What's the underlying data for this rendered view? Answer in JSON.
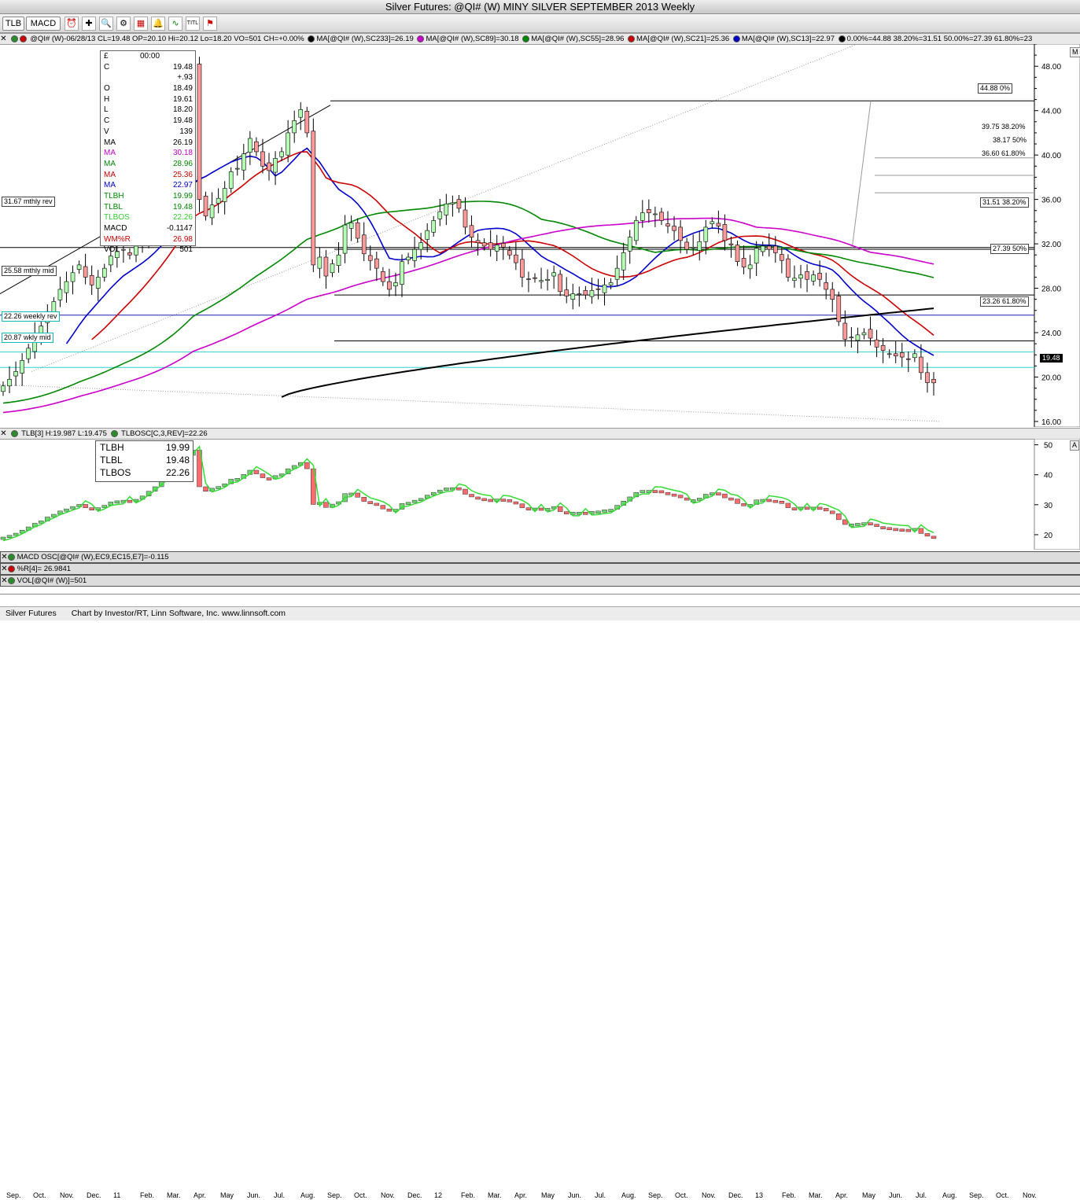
{
  "window": {
    "title": "Silver Futures: @QI# (W) MINY SILVER SEPTEMBER 2013 Weekly"
  },
  "toolbar": {
    "tlb_label": "TLB",
    "macd_label": "MACD"
  },
  "header": {
    "quote": "@QI# (W)-06/28/13 CL=19.48 OP=20.10 Hi=20.12 Lo=18.20 VO=501 CH=+0.00%",
    "ma233": "MA[@QI# (W),SC233]=26.19",
    "ma89": "MA[@QI# (W),SC89]=30.18",
    "ma55": "MA[@QI# (W),SC55]=28.96",
    "ma21": "MA[@QI# (W),SC21]=25.36",
    "ma13": "MA[@QI# (W),SC13]=22.97",
    "fib": "0.00%=44.88 38.20%=31.51 50.00%=27.39 61.80%=23"
  },
  "data_window": {
    "time": "00:00",
    "rows": [
      {
        "k": "C",
        "v": "19.48",
        "c": "#000"
      },
      {
        "k": "",
        "v": "+.93",
        "c": "#000"
      },
      {
        "k": "O",
        "v": "18.49",
        "c": "#000"
      },
      {
        "k": "H",
        "v": "19.61",
        "c": "#000"
      },
      {
        "k": "L",
        "v": "18.20",
        "c": "#000"
      },
      {
        "k": "C",
        "v": "19.48",
        "c": "#000"
      },
      {
        "k": "V",
        "v": "139",
        "c": "#000"
      },
      {
        "k": "MA",
        "v": "26.19",
        "c": "#000"
      },
      {
        "k": "MA",
        "v": "30.18",
        "c": "#cc00cc"
      },
      {
        "k": "MA",
        "v": "28.96",
        "c": "#008800"
      },
      {
        "k": "MA",
        "v": "25.36",
        "c": "#cc0000"
      },
      {
        "k": "MA",
        "v": "22.97",
        "c": "#0000cc"
      },
      {
        "k": "TLBH",
        "v": "19.99",
        "c": "#008800"
      },
      {
        "k": "TLBL",
        "v": "19.48",
        "c": "#008800"
      },
      {
        "k": "TLBOS",
        "v": "22.26",
        "c": "#33cc33"
      },
      {
        "k": "MACD",
        "v": "-0.1147",
        "c": "#000"
      },
      {
        "k": "WM%R",
        "v": "26.98",
        "c": "#cc0000"
      },
      {
        "k": "VOL",
        "v": "501",
        "c": "#000"
      }
    ]
  },
  "levels": {
    "mthly_rev": "31.67 mthly rev",
    "mthly_mid": "25.58 mthly mid",
    "weekly_rev": "22.26 weekly rev",
    "wkly_mid": "20.87 wkly mid",
    "fib0": "44.88 0%",
    "fib382a": "39.75 38.20%",
    "fib50a": "38.17 50%",
    "fib618a": "36.60 61.80%",
    "fib382": "31.51 38.20%",
    "fib50": "27.39 50%",
    "fib618": "23.26 61.80%",
    "last_price": "19.48"
  },
  "tlb_header": "TLB[3] H:19.987 L:19.475",
  "tlbosc_header": "TLBOSC[C,3,REV]=22.26",
  "tlb_box": {
    "rows": [
      {
        "k": "TLBH",
        "v": "19.99"
      },
      {
        "k": "TLBL",
        "v": "19.48"
      },
      {
        "k": "TLBOS",
        "v": "22.26"
      }
    ]
  },
  "sub_panels": {
    "macd": "MACD OSC[@QI# (W),EC9,EC15,E7]=-0.115",
    "wr": "%R[4]= 26.9841",
    "vol": "VOL[@QI# (W)]=501"
  },
  "footer": {
    "name": "Silver Futures",
    "credit": "Chart by Investor/RT, Linn Software, Inc. www.linnsoft.com"
  },
  "panel_buttons": {
    "main": "M",
    "sub": "A"
  },
  "chart_data": {
    "type": "candlestick",
    "title": "Silver Futures: @QI# (W) MINY SILVER SEPTEMBER 2013 Weekly",
    "ylim": [
      15.5,
      50
    ],
    "y_ticks": [
      16,
      20,
      24,
      28,
      32,
      36,
      40,
      44,
      48
    ],
    "y_tick_labels": [
      "16.00",
      "20.00",
      "24.00",
      "28.00",
      "32.00",
      "36.00",
      "40.00",
      "44.00",
      "48.00"
    ],
    "x_tick_labels": [
      "Sep.",
      "Oct.",
      "Nov.",
      "Dec.",
      "11",
      "Feb.",
      "Mar.",
      "Apr.",
      "May",
      "Jun.",
      "Jul.",
      "Aug.",
      "Sep.",
      "Oct.",
      "Nov.",
      "Dec.",
      "12",
      "Feb.",
      "Mar.",
      "Apr.",
      "May",
      "Jun.",
      "Jul.",
      "Aug.",
      "Sep.",
      "Oct.",
      "Nov.",
      "Dec.",
      "13",
      "Feb.",
      "Mar.",
      "Apr.",
      "May",
      "Jun.",
      "Jul.",
      "Aug.",
      "Sep.",
      "Oct.",
      "Nov."
    ],
    "close_path": [
      19.2,
      19.8,
      20.5,
      21.5,
      22.6,
      23.8,
      24.6,
      25.9,
      26.8,
      27.9,
      28.6,
      29.4,
      30.1,
      29.0,
      28.3,
      29.0,
      29.8,
      30.9,
      31.3,
      31.5,
      31.0,
      31.8,
      32.9,
      34.5,
      36.0,
      37.8,
      39.7,
      41.8,
      44.2,
      46.5,
      48.2,
      36.0,
      34.5,
      35.5,
      36.1,
      37.0,
      38.5,
      38.8,
      40.1,
      41.5,
      40.3,
      39.0,
      38.6,
      39.7,
      40.3,
      42.0,
      43.1,
      44.1,
      42.0,
      30.1,
      30.8,
      29.1,
      30.2,
      31.0,
      33.7,
      33.9,
      32.5,
      31.1,
      30.5,
      29.8,
      28.6,
      27.9,
      28.5,
      30.4,
      30.8,
      31.5,
      32.1,
      33.2,
      34.1,
      34.9,
      35.6,
      35.7,
      35.2,
      33.5,
      32.6,
      32.1,
      31.8,
      31.5,
      31.9,
      31.7,
      31.0,
      30.3,
      29.0,
      28.8,
      28.9,
      28.7,
      28.8,
      29.4,
      27.7,
      27.3,
      27.5,
      27.5,
      27.4,
      27.8,
      27.9,
      28.3,
      28.5,
      29.8,
      31.2,
      32.6,
      34.1,
      34.8,
      34.8,
      34.7,
      34.1,
      33.6,
      33.2,
      32.3,
      31.5,
      31.7,
      32.2,
      33.5,
      34.0,
      33.6,
      32.3,
      31.9,
      30.4,
      29.9,
      30.1,
      31.6,
      31.8,
      31.5,
      31.2,
      30.5,
      29.0,
      28.9,
      29.2,
      28.8,
      29.2,
      28.8,
      27.9,
      27.0,
      25.0,
      23.4,
      23.6,
      23.8,
      24.0,
      23.5,
      22.7,
      22.4,
      22.1,
      21.9,
      21.8,
      21.6,
      22.1,
      20.4,
      19.5,
      19.48
    ],
    "series": [
      {
        "name": "MA[@QI# (W),SC233]",
        "color": "#000000",
        "last": 26.19
      },
      {
        "name": "MA[@QI# (W),SC89]",
        "color": "#cc00cc",
        "last": 30.18
      },
      {
        "name": "MA[@QI# (W),SC55]",
        "color": "#008800",
        "last": 28.96
      },
      {
        "name": "MA[@QI# (W),SC21]",
        "color": "#cc0000",
        "last": 25.36
      },
      {
        "name": "MA[@QI# (W),SC13]",
        "color": "#0000cc",
        "last": 22.97
      }
    ],
    "horizontal_levels": [
      44.88,
      39.75,
      38.17,
      36.6,
      31.51,
      27.39,
      23.26,
      31.67,
      25.58,
      22.26,
      20.87
    ],
    "tlb_panel": {
      "ylim": [
        15,
        52
      ],
      "y_ticks": [
        20,
        30,
        40,
        50
      ],
      "tlbh": 19.99,
      "tlbl": 19.48,
      "tlbos": 22.26
    }
  }
}
